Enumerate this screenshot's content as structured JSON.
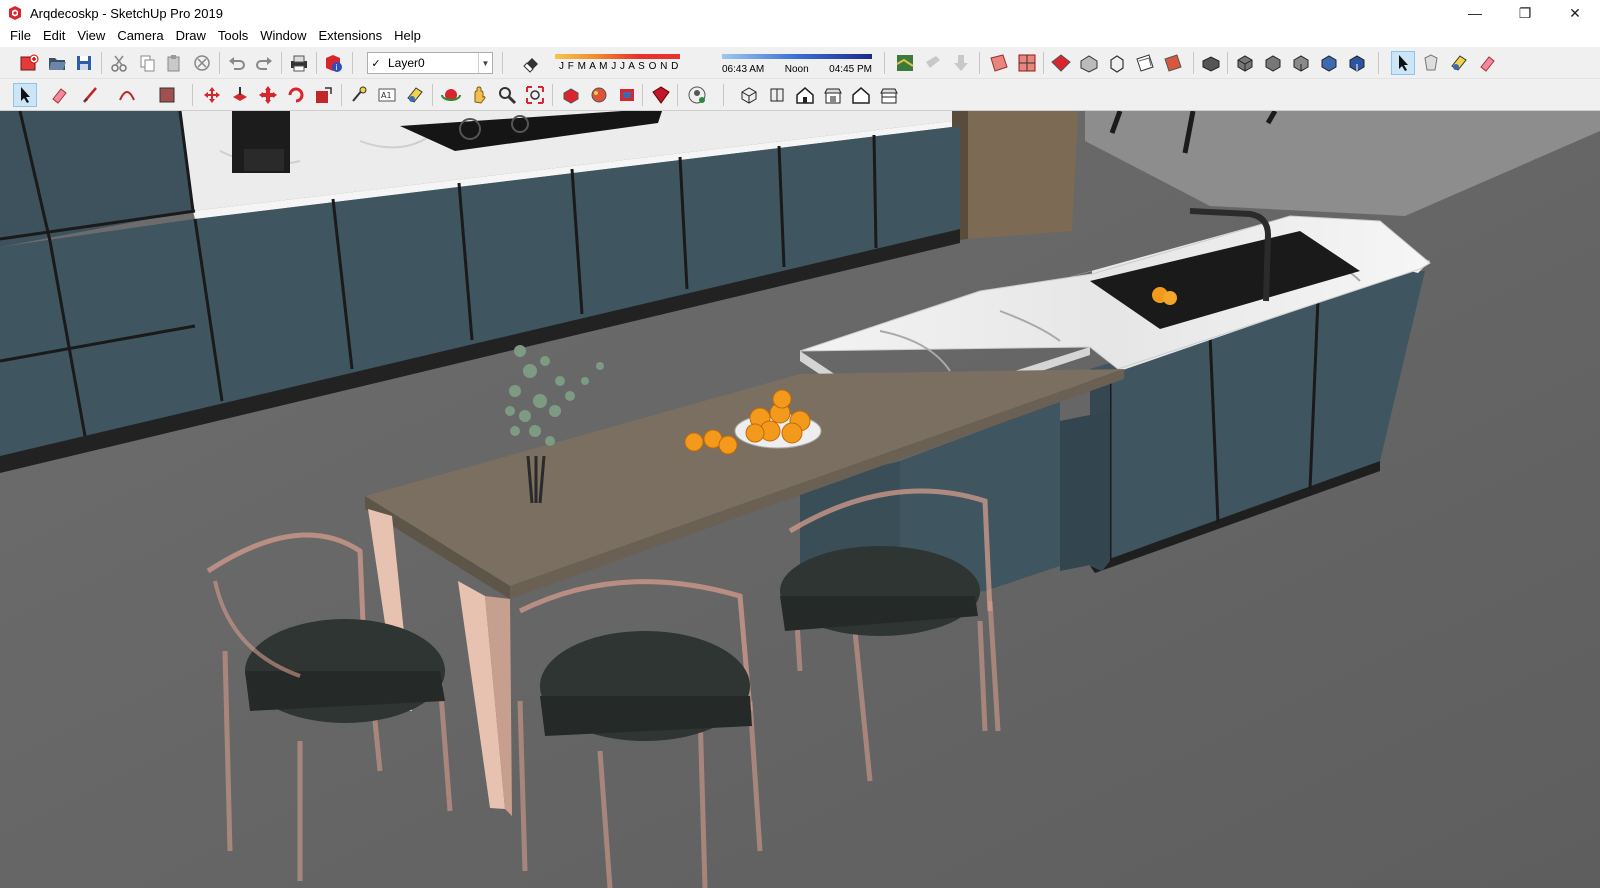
{
  "window": {
    "title": "Arqdecoskp - SketchUp Pro 2019",
    "controls": {
      "minimize": "—",
      "restore": "❐",
      "close": "✕"
    }
  },
  "menu": [
    "File",
    "Edit",
    "View",
    "Camera",
    "Draw",
    "Tools",
    "Window",
    "Extensions",
    "Help"
  ],
  "layer": {
    "selected": "Layer0",
    "check": "✓"
  },
  "shadow": {
    "months": "J  F  M  A  M  J  J  A  S  O  N  D",
    "time_start": "06:43 AM",
    "time_mid": "Noon",
    "time_end": "04:45 PM"
  },
  "icons": {
    "toolbar1": [
      "get-models-icon",
      "open-icon",
      "save-icon",
      "cut-icon",
      "copy-icon",
      "paste-icon",
      "erase-icon",
      "undo-icon",
      "redo-icon",
      "print-icon",
      "model-info-icon",
      "layer-eraser-icon",
      "warehouse-icon",
      "extension-warehouse-icon",
      "share-component-icon",
      "section-plane-icon",
      "section-display-icon",
      "xray-icon",
      "back-edges-icon",
      "wireframe-icon",
      "hidden-line-icon",
      "shaded-icon",
      "shaded-textures-icon",
      "monochrome-icon",
      "select-icon",
      "paint-icon",
      "eraser-icon"
    ],
    "toolbar2": [
      "select-icon",
      "eraser-icon",
      "line-icon",
      "arc-icon",
      "rectangle-icon",
      "push-pull-icon",
      "follow-me-icon",
      "move-icon",
      "rotate-icon",
      "scale-icon",
      "tape-measure-icon",
      "text-icon",
      "paint-bucket-icon",
      "orbit-icon",
      "pan-icon",
      "zoom-icon",
      "zoom-extents-icon",
      "components-icon",
      "materials-icon",
      "styles-icon",
      "warehouse-icon",
      "account-icon",
      "iso-view-icon",
      "top-view-icon",
      "front-view-icon",
      "right-view-icon",
      "back-view-icon",
      "left-view-icon"
    ]
  },
  "colors": {
    "cabinet": "#3f5560",
    "floor": "#686868",
    "table_top": "#7a6f61",
    "table_leg": "#e8c2b0",
    "marble": "#eeeeee",
    "orange": "#f39a1c",
    "chair_frame": "#d59c8c",
    "chair_seat": "#2e3533"
  }
}
